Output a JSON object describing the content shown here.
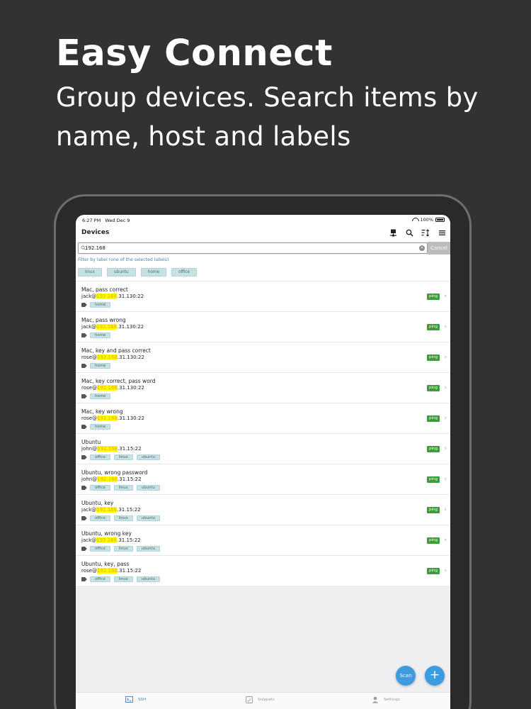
{
  "promo": {
    "title": "Easy Connect",
    "subtitle": "Group devices. Search items by name, host and labels"
  },
  "status": {
    "time": "6:27 PM",
    "date": "Wed Dec 9",
    "battery": "100%"
  },
  "nav": {
    "title": "Devices"
  },
  "search": {
    "value": "192.168",
    "cancel_label": "Cancel",
    "clear_glyph": "×"
  },
  "filter": {
    "label": "Filter by label (one of the selected labels)",
    "chips": [
      "linux",
      "ubuntu",
      "home",
      "office"
    ]
  },
  "devices": [
    {
      "name": "Mac, pass correct",
      "user": "jack@",
      "hl": "192.168",
      "rest": ".31.130:22",
      "tags": [
        "home"
      ],
      "ping": "ping"
    },
    {
      "name": "Mac, pass wrong",
      "user": "jack@",
      "hl": "192.168",
      "rest": ".31.130:22",
      "tags": [
        "home"
      ],
      "ping": "ping"
    },
    {
      "name": "Mac, key and pass correct",
      "user": "rose@",
      "hl": "192.168",
      "rest": ".31.130:22",
      "tags": [
        "home"
      ],
      "ping": "ping"
    },
    {
      "name": "Mac, key correct, pass word",
      "user": "rose@",
      "hl": "192.168",
      "rest": ".31.130:22",
      "tags": [
        "home"
      ],
      "ping": "ping"
    },
    {
      "name": "Mac, key wrong",
      "user": "rose@",
      "hl": "192.168",
      "rest": ".31.130:22",
      "tags": [
        "home"
      ],
      "ping": "ping"
    },
    {
      "name": "Ubuntu",
      "user": "john@",
      "hl": "192.168",
      "rest": ".31.15:22",
      "tags": [
        "office",
        "linux",
        "ubuntu"
      ],
      "ping": "ping"
    },
    {
      "name": "Ubuntu, wrong password",
      "user": "john@",
      "hl": "192.168",
      "rest": ".31.15:22",
      "tags": [
        "office",
        "linux",
        "ubuntu"
      ],
      "ping": "ping"
    },
    {
      "name": "Ubuntu, key",
      "user": "jack@",
      "hl": "192.168",
      "rest": ".31.15:22",
      "tags": [
        "office",
        "linux",
        "ubuntu"
      ],
      "ping": "ping"
    },
    {
      "name": "Ubuntu, wrong key",
      "user": "jack@",
      "hl": "192.168",
      "rest": ".31.15:22",
      "tags": [
        "office",
        "linux",
        "ubuntu"
      ],
      "ping": "ping"
    },
    {
      "name": "Ubuntu, key, pass",
      "user": "rose@",
      "hl": "192.168",
      "rest": ".31.15:22",
      "tags": [
        "office",
        "linux",
        "ubuntu"
      ],
      "ping": "ping"
    }
  ],
  "fab": {
    "scan_label": "Scan",
    "add_glyph": "+"
  },
  "tabs": [
    {
      "label": "SSH",
      "icon": "terminal-icon",
      "active": true
    },
    {
      "label": "Snippets",
      "icon": "snippets-icon",
      "active": false
    },
    {
      "label": "Settings",
      "icon": "person-icon",
      "active": false
    }
  ],
  "colors": {
    "accent": "#3d9be0",
    "ping": "#3e9c3a",
    "highlight": "#ffff00",
    "chip": "#c6e2e4",
    "background": "#323133"
  },
  "chevron_glyph": "›"
}
